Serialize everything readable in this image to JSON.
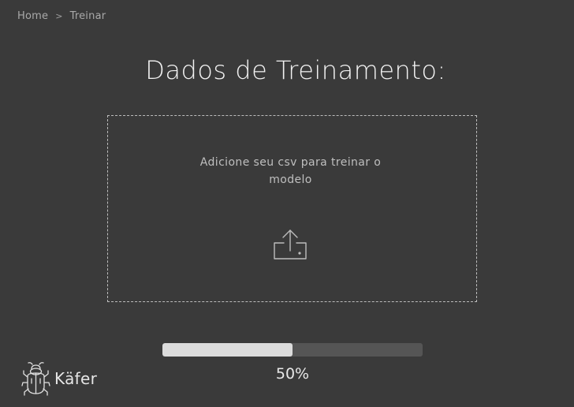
{
  "breadcrumb": {
    "home": "Home",
    "current": "Treinar",
    "separator": ">"
  },
  "page_title": "Dados de Treinamento:",
  "dropzone": {
    "text": "Adicione seu csv para treinar o modelo",
    "icon": "upload-icon"
  },
  "progress": {
    "value": 0.5,
    "label": "50%"
  },
  "brand": {
    "name": "Käfer",
    "logo": "beetle-logo"
  },
  "colors": {
    "background": "#3a3a3a",
    "progress_fill": "#dcdcdc",
    "text": "#f2f2f2"
  }
}
